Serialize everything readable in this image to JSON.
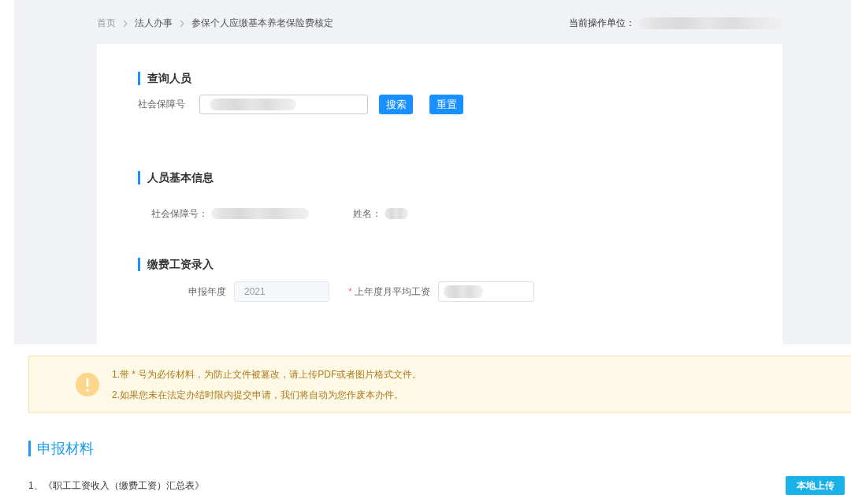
{
  "breadcrumb": [
    {
      "label": "首页",
      "kind": "home"
    },
    {
      "label": "法人办事",
      "kind": "page"
    },
    {
      "label": "参保个人应缴基本养老保险费核定",
      "kind": "page"
    }
  ],
  "operating_unit": {
    "label": "当前操作单位：",
    "redacted": true
  },
  "query": {
    "title": "查询人员",
    "field": {
      "label": "社会保障号",
      "redacted": true
    },
    "buttons": [
      "搜索",
      "重置"
    ]
  },
  "basic_info": {
    "title": "人员基本信息",
    "fields": [
      {
        "label": "社会保障号：",
        "redacted": true
      },
      {
        "label": "姓名：",
        "redacted": true
      }
    ]
  },
  "wage_entry": {
    "title": "缴费工资录入",
    "fields": [
      {
        "label": "申报年度",
        "value": "2021",
        "disabled": true
      },
      {
        "label": "上年度月平均工资",
        "required_mark": "*",
        "redacted": true,
        "disabled": false
      }
    ]
  },
  "notice": {
    "lines": [
      "1.带 * 号为必传材料，为防止文件被篡改，请上传PDF或者图片格式文件。",
      "2.如果您未在法定办结时限内提交申请，我们将自动为您作废本办件。"
    ]
  },
  "materials": {
    "title": "申报材料",
    "items": [
      {
        "label": "1、《职工工资收入（缴费工资）汇总表》",
        "button": "本地上传"
      }
    ]
  }
}
